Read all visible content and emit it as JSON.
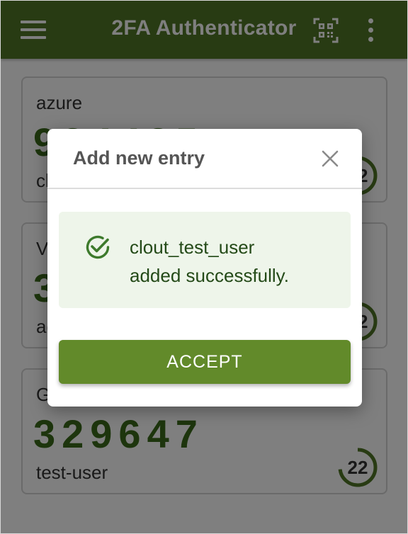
{
  "appbar": {
    "title": "2FA Authenticator",
    "menu_icon": "hamburger-menu-icon",
    "scan_icon": "qr-scan-icon",
    "more_icon": "more-vertical-icon",
    "color": "#507726"
  },
  "entries": [
    {
      "issuer": "azure",
      "code": "934435",
      "account": "clout_test_user",
      "timer": "22",
      "timer_remaining_fraction": 0.73
    },
    {
      "issuer": "Vault",
      "code": "301523",
      "account": "admin",
      "timer": "22",
      "timer_remaining_fraction": 0.73
    },
    {
      "issuer": "Google",
      "code": "329647",
      "account": "test-user",
      "timer": "22",
      "timer_remaining_fraction": 0.73
    }
  ],
  "dialog": {
    "title": "Add new entry",
    "close_icon": "close-icon",
    "alert": {
      "icon": "check-circle-icon",
      "line1": "clout_test_user",
      "line2": "added successfully."
    },
    "accept_label": "ACCEPT"
  },
  "colors": {
    "primary": "#507726",
    "code_text": "#3b6a1a",
    "button": "#628a2a",
    "success_bg": "#eef5ea"
  }
}
